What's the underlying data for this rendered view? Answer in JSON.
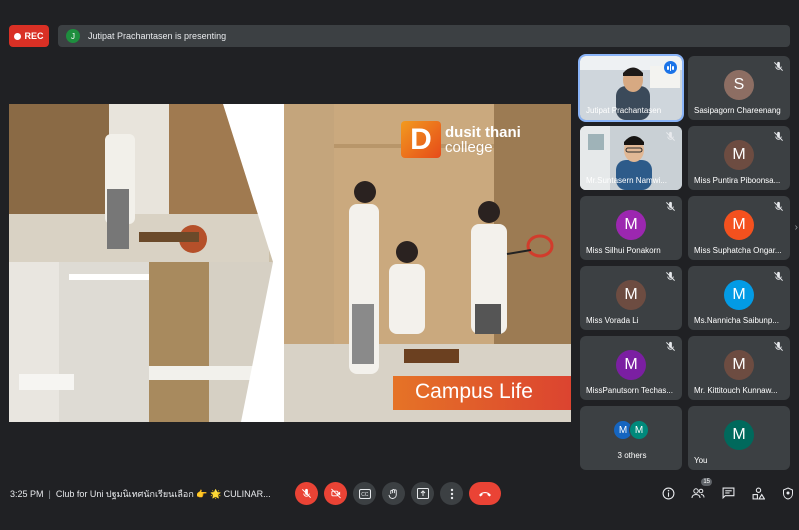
{
  "recording": {
    "label": "REC"
  },
  "presenter": {
    "initial": "J",
    "text": "Jutipat Prachantasen is presenting"
  },
  "slide": {
    "brand_line1": "dusit thani",
    "brand_line2": "college",
    "caption": "Campus Life"
  },
  "participants": [
    {
      "name": "Jutipat Prachantasen",
      "type": "video",
      "speaking": true
    },
    {
      "name": "Sasipagorn Chareenang",
      "initial": "S",
      "color": "#8d6e63"
    },
    {
      "name": "Mr.Suntasern Namwi...",
      "type": "video"
    },
    {
      "name": "Miss Puntira Piboonsa...",
      "initial": "M",
      "color": "#6d4c41"
    },
    {
      "name": "Miss Silhui Ponakorn",
      "initial": "M",
      "color": "#9c27b0"
    },
    {
      "name": "Miss Suphatcha Ongar...",
      "initial": "M",
      "color": "#f4511e"
    },
    {
      "name": "Miss Vorada Li",
      "initial": "M",
      "color": "#6d4c41"
    },
    {
      "name": "Ms.Nannicha Saibunp...",
      "initial": "M",
      "color": "#039be5"
    },
    {
      "name": "MissPanutsorn Techas...",
      "initial": "M",
      "color": "#7b1fa2"
    },
    {
      "name": "Mr. Kittitouch Kunnaw...",
      "initial": "M",
      "color": "#6d4c41"
    },
    {
      "name": "3 others",
      "others": [
        "M",
        "M"
      ],
      "others_colors": [
        "#1565c0",
        "#00897b"
      ]
    },
    {
      "name": "You",
      "initial": "M",
      "color": "#00695c"
    }
  ],
  "bottom": {
    "time": "3:25 PM",
    "meeting_title": "Club for Uni ปฐมนิเทศนักเรียนเลือก 👉 🌟 CULINAR...",
    "people_count": "15"
  },
  "icons": {
    "mic_off": "mic-off-icon",
    "cam_off": "videocam-off-icon",
    "captions": "closed-caption-icon",
    "hand": "raise-hand-icon",
    "present": "present-screen-icon",
    "more": "more-vert-icon",
    "hangup": "call-end-icon",
    "info": "info-icon",
    "people": "people-icon",
    "chat": "chat-icon",
    "activities": "activities-icon",
    "host": "host-controls-icon"
  }
}
